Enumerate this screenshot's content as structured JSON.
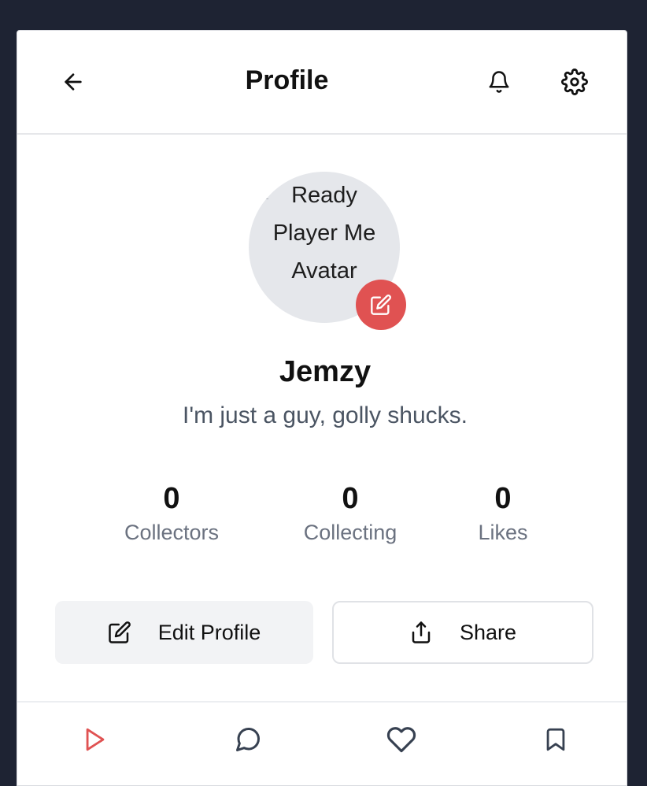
{
  "header": {
    "title": "Profile",
    "back_icon": "arrow-left-icon",
    "notifications_icon": "bell-icon",
    "settings_icon": "gear-icon"
  },
  "profile": {
    "avatar_alt": "Ready Player Me Avatar",
    "avatar_edit_icon": "pencil-square-icon",
    "username": "Jemzy",
    "bio": "I'm just a guy, golly shucks."
  },
  "stats": [
    {
      "value": "0",
      "label": "Collectors"
    },
    {
      "value": "0",
      "label": "Collecting"
    },
    {
      "value": "0",
      "label": "Likes"
    }
  ],
  "actions": {
    "edit_label": "Edit Profile",
    "edit_icon": "pencil-square-icon",
    "share_label": "Share",
    "share_icon": "share-icon"
  },
  "bottom_nav": {
    "items": [
      "play-icon",
      "chat-bubble-icon",
      "heart-icon",
      "bookmark-icon"
    ],
    "active_item": "play-icon"
  },
  "colors": {
    "accent": "#e05252",
    "background": "#1e2333",
    "card": "#ffffff",
    "muted_text": "#6b7280"
  }
}
